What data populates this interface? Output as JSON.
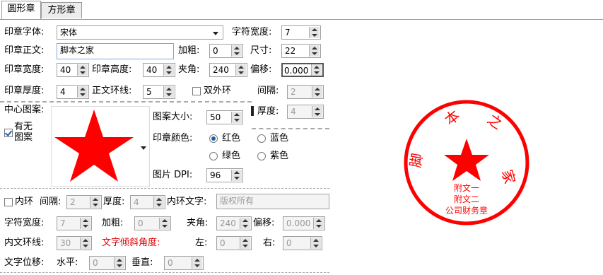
{
  "tabs": [
    "圆形章",
    "方形章"
  ],
  "form": {
    "font_label": "印章字体:",
    "font_value": "宋体",
    "char_width_label": "字符宽度:",
    "char_width_value": "7",
    "text_label": "印章正文:",
    "text_value": "脚本之家",
    "bold_label": "加粗:",
    "bold_value": "0",
    "size_label": "尺寸:",
    "size_value": "22",
    "width_label": "印章宽度:",
    "width_value": "40",
    "height_label": "印章高度:",
    "height_value": "40",
    "angle_label": "夹角:",
    "angle_value": "240",
    "offset_label": "偏移:",
    "offset_value": "0.000",
    "thickness_label": "印章厚度:",
    "thickness_value": "4",
    "ring_label": "正文环线:",
    "ring_value": "5",
    "double_ring_label": "双外环",
    "gap_label": "间隔:",
    "gap_value": "2",
    "thick2_label": "厚度:",
    "thick2_value": "4"
  },
  "center": {
    "label": "中心图案:",
    "has_pattern_label_1": "有无",
    "has_pattern_label_2": "图案",
    "has_pattern_checked": true,
    "size_label": "图案大小:",
    "size_value": "50",
    "color_label": "印章颜色:",
    "colors": [
      "红色",
      "蓝色",
      "绿色",
      "紫色"
    ],
    "selected_color": "红色",
    "dpi_label": "图片 DPI:",
    "dpi_value": "96",
    "star_color": "#ff0000"
  },
  "inner": {
    "inner_ring_label": "内环",
    "gap_label": "间隔:",
    "gap_value": "2",
    "thick_label": "厚度:",
    "thick_value": "4",
    "inner_text_label": "内环文字:",
    "inner_text_value": "版权所有",
    "char_width_label": "字符宽度:",
    "char_width_value": "7",
    "bold_label": "加粗:",
    "bold_value": "0",
    "angle_label": "夹角:",
    "angle_value": "240",
    "offset_label": "偏移:",
    "offset_value": "0.000",
    "ring_label": "内文环线:",
    "ring_value": "30",
    "tilt_label": "文字倾斜角度:",
    "left_label": "左:",
    "left_value": "0",
    "right_label": "右:",
    "right_value": "0",
    "shift_label": "文字位移:",
    "horiz_label": "水平:",
    "horiz_value": "0",
    "vert_label": "垂直:",
    "vert_value": "0"
  },
  "seal": {
    "ring_color": "#ff0000",
    "text_1": "附文一",
    "text_2": "附文二",
    "text_3": "公司财务章"
  }
}
